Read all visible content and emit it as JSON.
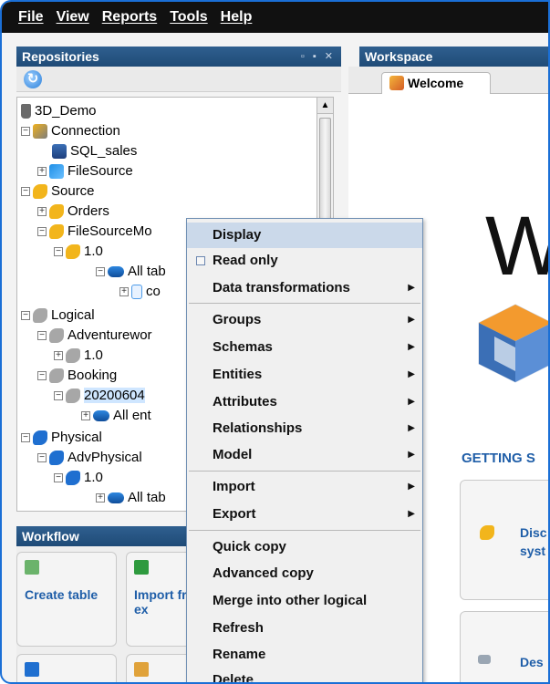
{
  "menubar": {
    "items": [
      "File",
      "View",
      "Reports",
      "Tools",
      "Help"
    ]
  },
  "repositories": {
    "title": "Repositories",
    "tree": [
      {
        "label": "3D_Demo",
        "icon": "repository-icon"
      },
      {
        "label": "Connection",
        "icon": "connection-icon"
      },
      {
        "label": "SQL_sales",
        "icon": "sql-server-icon"
      },
      {
        "label": "FileSource",
        "icon": "file-source-icon"
      },
      {
        "label": "Source",
        "icon": "source-model-icon"
      },
      {
        "label": "Orders",
        "icon": "source-model-icon"
      },
      {
        "label": "FileSourceMo",
        "icon": "source-model-icon"
      },
      {
        "label": "1.0",
        "icon": "version-icon"
      },
      {
        "label": "All tab",
        "icon": "tables-icon"
      },
      {
        "label": "co",
        "icon": "document-icon"
      },
      {
        "label": "Logical",
        "icon": "logical-model-icon"
      },
      {
        "label": "Adventurewor",
        "icon": "logical-model-icon"
      },
      {
        "label": "1.0",
        "icon": "version-icon"
      },
      {
        "label": "Booking",
        "icon": "logical-model-icon"
      },
      {
        "label": "20200604",
        "icon": "logical-version-icon"
      },
      {
        "label": "All ent",
        "icon": "entities-icon"
      },
      {
        "label": "Physical",
        "icon": "physical-model-icon"
      },
      {
        "label": "AdvPhysical",
        "icon": "physical-model-icon"
      },
      {
        "label": "1.0",
        "icon": "version-icon"
      },
      {
        "label": "All tab",
        "icon": "tables-icon"
      }
    ]
  },
  "workflow": {
    "title": "Workflow",
    "tiles": [
      {
        "label": "Create table"
      },
      {
        "label": "Import from ex"
      }
    ]
  },
  "workspace": {
    "title": "Workspace",
    "tab_label": "Welcome",
    "big_letter": "W",
    "getting_started": "GETTING S",
    "cards": [
      {
        "label": "Disc syst"
      },
      {
        "label": "Des"
      }
    ]
  },
  "context_menu": {
    "items": [
      {
        "label": "Display",
        "highlighted": true
      },
      {
        "label": "Read only",
        "checkbox": true
      },
      {
        "label": "Data transformations",
        "submenu": true
      },
      {
        "label": "Groups",
        "submenu": true
      },
      {
        "label": "Schemas",
        "submenu": true
      },
      {
        "label": "Entities",
        "submenu": true
      },
      {
        "label": "Attributes",
        "submenu": true
      },
      {
        "label": "Relationships",
        "submenu": true
      },
      {
        "label": "Model",
        "submenu": true
      },
      {
        "label": "Import",
        "submenu": true
      },
      {
        "label": "Export",
        "submenu": true
      },
      {
        "label": "Quick copy"
      },
      {
        "label": "Advanced copy"
      },
      {
        "label": "Merge into other logical"
      },
      {
        "label": "Refresh"
      },
      {
        "label": "Rename"
      },
      {
        "label": "Delete"
      }
    ]
  },
  "colors": {
    "menubar_bg": "#111111",
    "panel_header": "#2f5f8f",
    "accent_blue": "#1f5ea8",
    "menu_highlight": "#cbd9ea"
  }
}
